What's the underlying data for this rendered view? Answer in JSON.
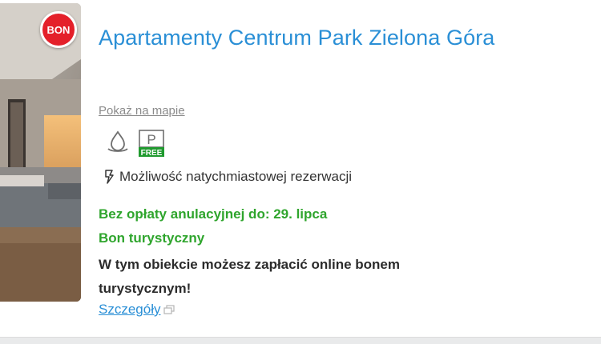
{
  "badge": {
    "label": "BON",
    "color": "#e4202a"
  },
  "listing": {
    "title": "Apartamenty Centrum Park Zielona Góra",
    "map_link": "Pokaż na mapie",
    "amenities": [
      {
        "icon": "water-drop-icon"
      },
      {
        "icon": "free-parking-icon",
        "top_label": "P",
        "bottom_label": "FREE"
      }
    ],
    "instant_icon": "lightning-icon",
    "instant_booking": "Możliwość natychmiastowej rezerwacji",
    "free_cancellation": "Bez opłaty anulacyjnej do: 29. lipca",
    "bon_title": "Bon turystyczny",
    "bon_description": "W tym obiekcie możesz zapłacić online bonem turystycznym!",
    "details_link": "Szczegóły",
    "details_icon": "external-window-icon"
  },
  "colors": {
    "title": "#2a8fd6",
    "green": "#2fa52d",
    "free_badge": "#1f9a2e"
  }
}
